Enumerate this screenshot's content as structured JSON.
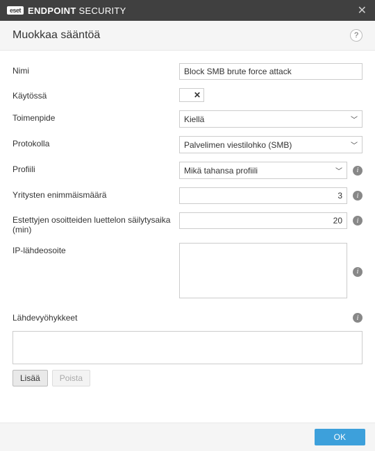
{
  "titlebar": {
    "brand_badge": "eset",
    "brand_bold": "ENDPOINT",
    "brand_light": " SECURITY"
  },
  "header": {
    "title": "Muokkaa sääntöä"
  },
  "fields": {
    "name_label": "Nimi",
    "name_value": "Block SMB brute force attack",
    "enabled_label": "Käytössä",
    "action_label": "Toimenpide",
    "action_value": "Kiellä",
    "protocol_label": "Protokolla",
    "protocol_value": "Palvelimen viestilohko (SMB)",
    "profile_label": "Profiili",
    "profile_value": "Mikä tahansa profiili",
    "max_attempts_label": "Yritysten enimmäismäärä",
    "max_attempts_value": "3",
    "retain_label": "Estettyjen osoitteiden luettelon säilytysaika (min)",
    "retain_value": "20",
    "ip_source_label": "IP-lähdeosoite",
    "ip_source_value": "",
    "zones_label": "Lähdevyöhykkeet"
  },
  "buttons": {
    "add": "Lisää",
    "remove": "Poista",
    "ok": "OK"
  }
}
